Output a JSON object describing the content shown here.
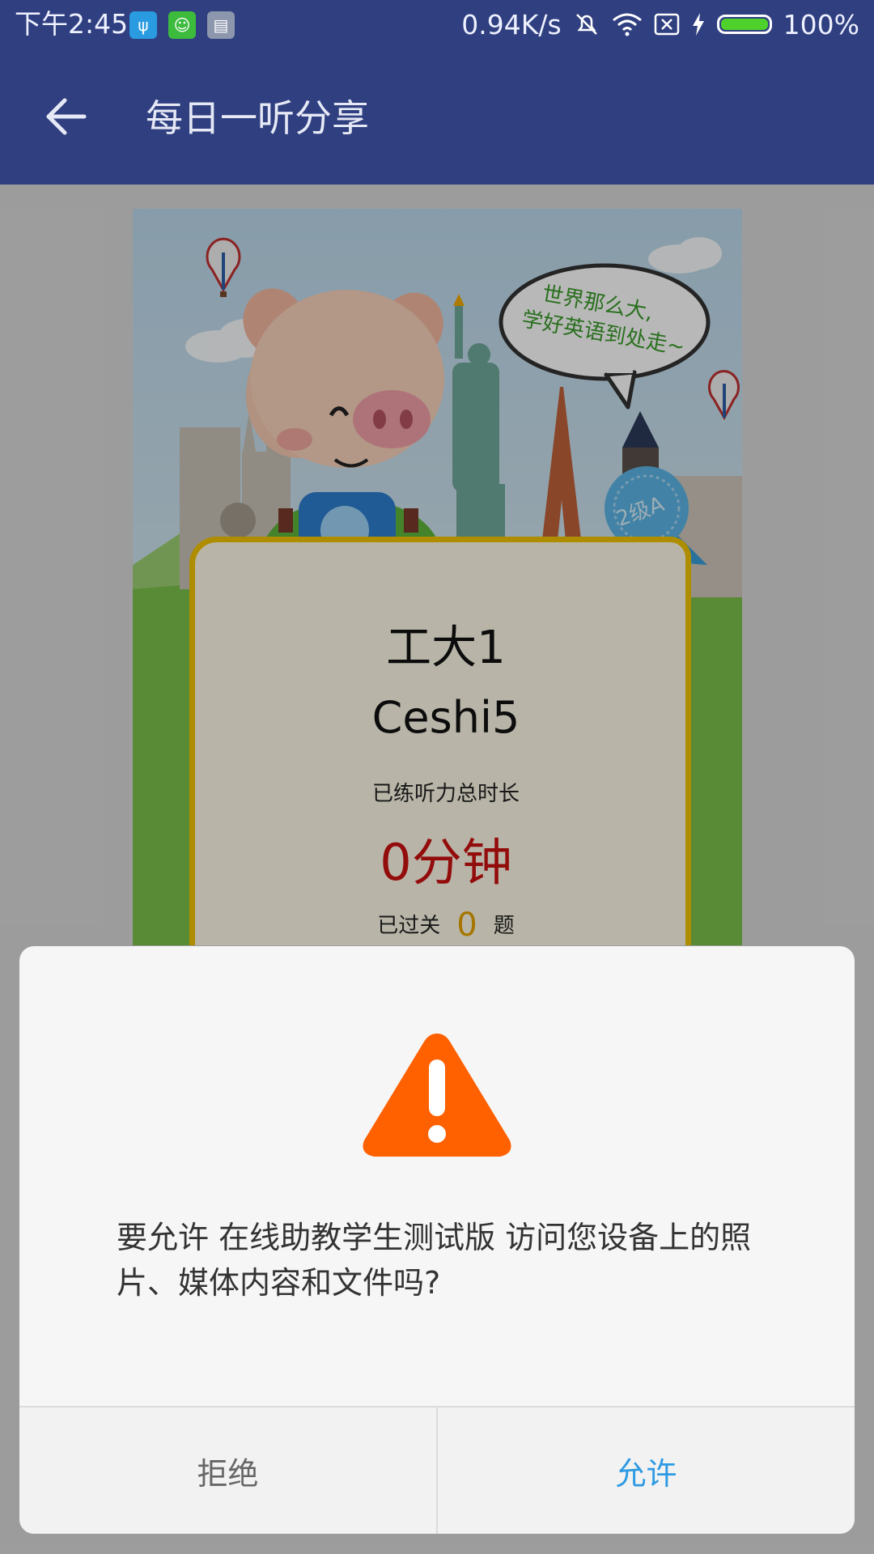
{
  "status_bar": {
    "time": "下午2:45",
    "speed": "0.94K/s",
    "battery_percent": "100%",
    "battery_level": 1.0,
    "icons": [
      "usb-icon",
      "android-debug-icon",
      "sim-icon",
      "mute-icon",
      "wifi-icon",
      "no-sim-icon",
      "charging-icon",
      "battery-icon"
    ]
  },
  "app_bar": {
    "title": "每日一听分享",
    "back_icon": "arrow-left-icon"
  },
  "share_card": {
    "bubble_line1": "世界那么大,",
    "bubble_line2": "学好英语到处走~",
    "badge": "2级A",
    "school": "工大1",
    "username": "Ceshi5",
    "practice_label": "已练听力总时长",
    "duration": "0分钟",
    "passed_prefix": "已过关",
    "passed_count": "0",
    "passed_suffix": "题"
  },
  "dialog": {
    "icon": "warning-icon",
    "message": "要允许 在线助教学生测试版 访问您设备上的照片、媒体内容和文件吗?",
    "deny_label": "拒绝",
    "allow_label": "允许",
    "colors": {
      "warning": "#ff6000",
      "allow": "#2d9ae3",
      "header": "#2f3f80"
    }
  }
}
